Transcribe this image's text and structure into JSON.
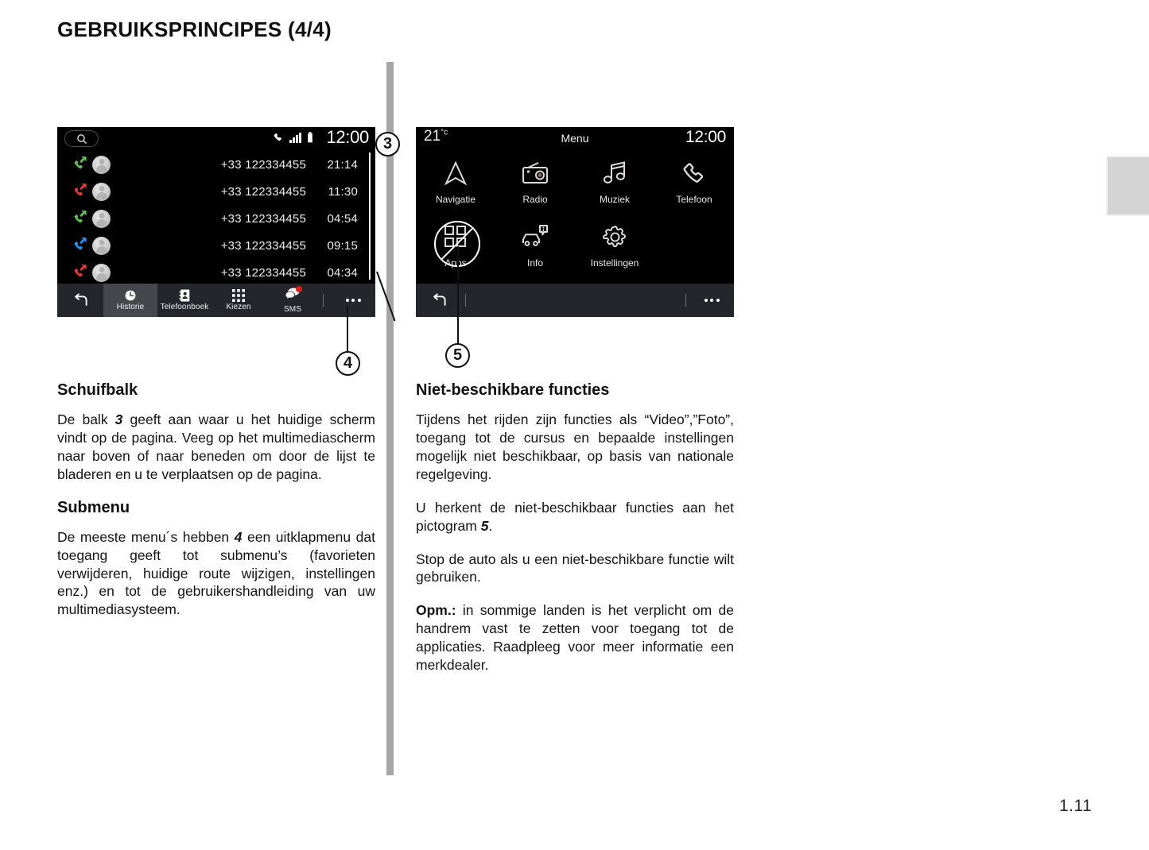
{
  "document": {
    "title": "GEBRUIKSPRINCIPES (4/4)",
    "page_number": "1.11"
  },
  "phone_screen": {
    "search_icon": "search-icon",
    "status_icons": [
      "phone-handset-icon",
      "signal-bars-icon",
      "battery-icon"
    ],
    "clock": "12:00",
    "calls": [
      {
        "direction": "incoming",
        "color": "#5ec24b",
        "number": "+33 122334455",
        "time": "21:14"
      },
      {
        "direction": "missed",
        "color": "#e53935",
        "number": "+33 122334455",
        "time": "11:30"
      },
      {
        "direction": "incoming",
        "color": "#5ec24b",
        "number": "+33 122334455",
        "time": "04:54"
      },
      {
        "direction": "outgoing",
        "color": "#2196f3",
        "number": "+33 122334455",
        "time": "09:15"
      },
      {
        "direction": "missed",
        "color": "#e53935",
        "number": "+33 122334455",
        "time": "04:34"
      }
    ],
    "toolbar": {
      "back_icon": "back-arrow-icon",
      "tabs": [
        {
          "label": "Historie",
          "icon": "clock-icon",
          "active": true
        },
        {
          "label": "Telefoonboek",
          "icon": "contact-card-icon",
          "active": false
        },
        {
          "label": "Kiezen",
          "icon": "keypad-icon",
          "active": false
        },
        {
          "label": "SMS",
          "icon": "sms-bubble-icon",
          "active": false,
          "badge": true
        }
      ],
      "overflow_icon": "more-dots-icon"
    }
  },
  "menu_screen": {
    "temperature": "21",
    "temperature_unit": "°c",
    "title": "Menu",
    "clock": "12:00",
    "items": [
      {
        "label": "Navigatie",
        "icon": "navigation-arrow-icon",
        "blocked": false
      },
      {
        "label": "Radio",
        "icon": "radio-icon",
        "blocked": false
      },
      {
        "label": "Muziek",
        "icon": "music-notes-icon",
        "blocked": false
      },
      {
        "label": "Telefoon",
        "icon": "phone-handset-icon",
        "blocked": false
      },
      {
        "label": "Apps",
        "icon": "apps-grid-icon",
        "blocked": true
      },
      {
        "label": "Info",
        "icon": "car-info-icon",
        "blocked": false
      },
      {
        "label": "Instellingen",
        "icon": "gear-icon",
        "blocked": false
      }
    ],
    "toolbar": {
      "back_icon": "back-arrow-icon",
      "overflow_icon": "more-dots-icon"
    }
  },
  "callouts": {
    "three": "3",
    "four": "4",
    "five": "5"
  },
  "left_column": {
    "heading_1": "Schuifbalk",
    "para_1_a": "De balk ",
    "para_1_ref": "3",
    "para_1_b": " geeft aan waar u het huidige scherm vindt op de pagina. Veeg op het multimediascherm naar boven of naar beneden om door de lijst te bladeren en u te verplaatsen op de pagina.",
    "heading_2": "Submenu",
    "para_2_a": "De meeste menu´s hebben ",
    "para_2_ref": "4",
    "para_2_b": " een uitklapmenu dat toegang geeft tot submenu’s (favorieten verwijderen, huidige route wijzigen, instellingen enz.) en tot de gebruikershandleiding van uw multimediasysteem."
  },
  "right_column": {
    "heading_1": "Niet-beschikbare functies",
    "para_1": "Tijdens het rijden zijn functies als “Video”,”Foto”, toegang tot de cursus en bepaalde instellingen mogelijk niet beschikbaar, op basis van nationale regelgeving.",
    "para_2_a": "U herkent de niet-beschikbaar functies aan het pictogram ",
    "para_2_ref": "5",
    "para_2_b": ".",
    "para_3": "Stop de auto als u een niet-beschikbare functie wilt gebruiken.",
    "para_4_label": "Opm.:",
    "para_4_body": " in sommige landen is het verplicht om de handrem vast te zetten voor toegang tot de applicaties. Raadpleeg voor meer informatie een merkdealer."
  }
}
